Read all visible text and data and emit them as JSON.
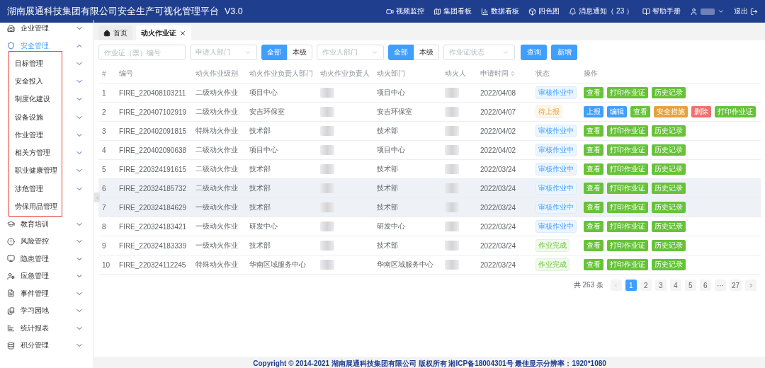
{
  "header": {
    "title": "湖南展通科技集团有限公司安全生产可视化管理平台",
    "version": "V3.0",
    "nav": [
      {
        "label": "视频监控"
      },
      {
        "label": "集团看板"
      },
      {
        "label": "数据看板"
      },
      {
        "label": "四色图"
      },
      {
        "label": "消息通知（ 23 ）"
      },
      {
        "label": "帮助手册"
      }
    ],
    "logout": "退出"
  },
  "sidebar": {
    "items": [
      {
        "label": "企业管理",
        "expanded": false
      },
      {
        "label": "安全管理",
        "expanded": true,
        "children": [
          {
            "label": "目标管理",
            "expandable": true
          },
          {
            "label": "安全投入",
            "expandable": true
          },
          {
            "label": "制度化建设",
            "expandable": true
          },
          {
            "label": "设备设施",
            "expandable": true
          },
          {
            "label": "作业管理",
            "expandable": true
          },
          {
            "label": "相关方管理",
            "expandable": true
          },
          {
            "label": "职业健康管理",
            "expandable": true
          },
          {
            "label": "涉危管理",
            "expandable": true
          },
          {
            "label": "劳保用品管理",
            "expandable": false
          }
        ]
      },
      {
        "label": "教育培训",
        "expanded": false
      },
      {
        "label": "风险管控",
        "expanded": false
      },
      {
        "label": "隐患管理",
        "expanded": false
      },
      {
        "label": "应急管理",
        "expanded": false
      },
      {
        "label": "事件管理",
        "expanded": false
      },
      {
        "label": "学习园地",
        "expanded": false
      },
      {
        "label": "统计报表",
        "expanded": false
      },
      {
        "label": "积分管理",
        "expanded": false
      }
    ]
  },
  "tabs": [
    {
      "label": "首页",
      "kind": "home",
      "selected": false
    },
    {
      "label": "动火作业证",
      "kind": "page",
      "selected": true
    }
  ],
  "filters": [
    {
      "kind": "input",
      "placeholder": "作业证（票）编号"
    },
    {
      "kind": "select",
      "placeholder": "申请人部门"
    },
    {
      "kind": "toggle",
      "options": [
        {
          "label": "全部",
          "selected": true
        },
        {
          "label": "本级",
          "selected": false
        }
      ]
    },
    {
      "kind": "select",
      "placeholder": "作业人部门"
    },
    {
      "kind": "toggle",
      "options": [
        {
          "label": "全部",
          "selected": true
        },
        {
          "label": "本级",
          "selected": false
        }
      ]
    },
    {
      "kind": "select",
      "placeholder": "作业证状态"
    },
    {
      "kind": "button",
      "label": "查询"
    },
    {
      "kind": "button",
      "label": "新增"
    }
  ],
  "table": {
    "columns": [
      {
        "label": "#",
        "sortable": false
      },
      {
        "label": "编号",
        "sortable": false
      },
      {
        "label": "动火作业级别",
        "sortable": false
      },
      {
        "label": "动火作业负责人部门",
        "sortable": false
      },
      {
        "label": "动火作业负责人",
        "sortable": false
      },
      {
        "label": "动火部门",
        "sortable": false
      },
      {
        "label": "动火人",
        "sortable": false
      },
      {
        "label": "申请时间",
        "sortable": true
      },
      {
        "label": "状态",
        "sortable": false
      },
      {
        "label": "操作",
        "sortable": false
      }
    ],
    "rows": [
      {
        "no": "1",
        "code": "FIRE_220408103211",
        "level": "二级动火作业",
        "owner_dept": "项目中心",
        "dept": "项目中心",
        "date": "2022/04/08",
        "status": {
          "label": "审核作业中",
          "kind": "review"
        },
        "highlighted": false,
        "actions": [
          {
            "label": "查看",
            "kind": "green"
          },
          {
            "label": "打印作业证",
            "kind": "green"
          },
          {
            "label": "历史记录",
            "kind": "green"
          }
        ]
      },
      {
        "no": "2",
        "code": "FIRE_220407102919",
        "level": "二级动火作业",
        "owner_dept": "安吉环保室",
        "dept": "安吉环保室",
        "date": "2022/04/07",
        "status": {
          "label": "待上报",
          "kind": "pending"
        },
        "highlighted": false,
        "actions": [
          {
            "label": "上报",
            "kind": "blue"
          },
          {
            "label": "编辑",
            "kind": "blue"
          },
          {
            "label": "查看",
            "kind": "green"
          },
          {
            "label": "安全措施",
            "kind": "orange"
          },
          {
            "label": "删除",
            "kind": "red"
          },
          {
            "label": "打印作业证",
            "kind": "green"
          }
        ]
      },
      {
        "no": "3",
        "code": "FIRE_220402091815",
        "level": "特殊动火作业",
        "owner_dept": "技术部",
        "dept": "技术部",
        "date": "2022/04/02",
        "status": {
          "label": "审核作业中",
          "kind": "review"
        },
        "highlighted": false,
        "actions": [
          {
            "label": "查看",
            "kind": "green"
          },
          {
            "label": "打印作业证",
            "kind": "green"
          },
          {
            "label": "历史记录",
            "kind": "green"
          }
        ]
      },
      {
        "no": "4",
        "code": "FIRE_220402090638",
        "level": "二级动火作业",
        "owner_dept": "项目中心",
        "dept": "项目中心",
        "date": "2022/04/02",
        "status": {
          "label": "审核作业中",
          "kind": "review"
        },
        "highlighted": false,
        "actions": [
          {
            "label": "查看",
            "kind": "green"
          },
          {
            "label": "打印作业证",
            "kind": "green"
          },
          {
            "label": "历史记录",
            "kind": "green"
          }
        ]
      },
      {
        "no": "5",
        "code": "FIRE_220324191615",
        "level": "二级动火作业",
        "owner_dept": "技术部",
        "dept": "技术部",
        "date": "2022/03/24",
        "status": {
          "label": "审核作业中",
          "kind": "review"
        },
        "highlighted": false,
        "actions": [
          {
            "label": "查看",
            "kind": "green"
          },
          {
            "label": "打印作业证",
            "kind": "green"
          },
          {
            "label": "历史记录",
            "kind": "green"
          }
        ]
      },
      {
        "no": "6",
        "code": "FIRE_220324185732",
        "level": "二级动火作业",
        "owner_dept": "技术部",
        "dept": "技术部",
        "date": "2022/03/24",
        "status": {
          "label": "审核作业中",
          "kind": "review"
        },
        "highlighted": true,
        "actions": [
          {
            "label": "查看",
            "kind": "green"
          },
          {
            "label": "打印作业证",
            "kind": "green"
          },
          {
            "label": "历史记录",
            "kind": "green"
          }
        ]
      },
      {
        "no": "7",
        "code": "FIRE_220324184629",
        "level": "一级动火作业",
        "owner_dept": "技术部",
        "dept": "技术部",
        "date": "2022/03/24",
        "status": {
          "label": "审核作业中",
          "kind": "review"
        },
        "highlighted": true,
        "actions": [
          {
            "label": "查看",
            "kind": "green"
          },
          {
            "label": "打印作业证",
            "kind": "green"
          },
          {
            "label": "历史记录",
            "kind": "green"
          }
        ]
      },
      {
        "no": "8",
        "code": "FIRE_220324183421",
        "level": "一级动火作业",
        "owner_dept": "研发中心",
        "dept": "研发中心",
        "date": "2022/03/24",
        "status": {
          "label": "审核作业中",
          "kind": "review"
        },
        "highlighted": false,
        "actions": [
          {
            "label": "查看",
            "kind": "green"
          },
          {
            "label": "打印作业证",
            "kind": "green"
          },
          {
            "label": "历史记录",
            "kind": "green"
          }
        ]
      },
      {
        "no": "9",
        "code": "FIRE_220324183339",
        "level": "一级动火作业",
        "owner_dept": "技术部",
        "dept": "技术部",
        "date": "2022/03/24",
        "status": {
          "label": "作业完成",
          "kind": "done"
        },
        "highlighted": false,
        "actions": [
          {
            "label": "查看",
            "kind": "green"
          },
          {
            "label": "打印作业证",
            "kind": "green"
          },
          {
            "label": "历史记录",
            "kind": "green"
          }
        ]
      },
      {
        "no": "10",
        "code": "FIRE_220324112245",
        "level": "特殊动火作业",
        "owner_dept": "华南区域服务中心",
        "dept": "华南区域服务中心",
        "date": "2022/03/24",
        "status": {
          "label": "作业完成",
          "kind": "done"
        },
        "highlighted": false,
        "actions": [
          {
            "label": "查看",
            "kind": "green"
          },
          {
            "label": "打印作业证",
            "kind": "green"
          },
          {
            "label": "历史记录",
            "kind": "green"
          }
        ]
      }
    ]
  },
  "pagination": {
    "total": "共 263 条",
    "pages": [
      {
        "label": "1",
        "selected": true
      },
      {
        "label": "2",
        "selected": false
      },
      {
        "label": "3",
        "selected": false
      },
      {
        "label": "4",
        "selected": false
      },
      {
        "label": "5",
        "selected": false
      },
      {
        "label": "6",
        "selected": false
      },
      {
        "label": "···",
        "selected": false
      },
      {
        "label": "27",
        "selected": false
      }
    ]
  },
  "footer": {
    "text": "Copyright © 2014-2021 湖南展通科技集团有限公司 版权所有 湘ICP备18004301号 最佳显示分辨率：1920*1080"
  }
}
